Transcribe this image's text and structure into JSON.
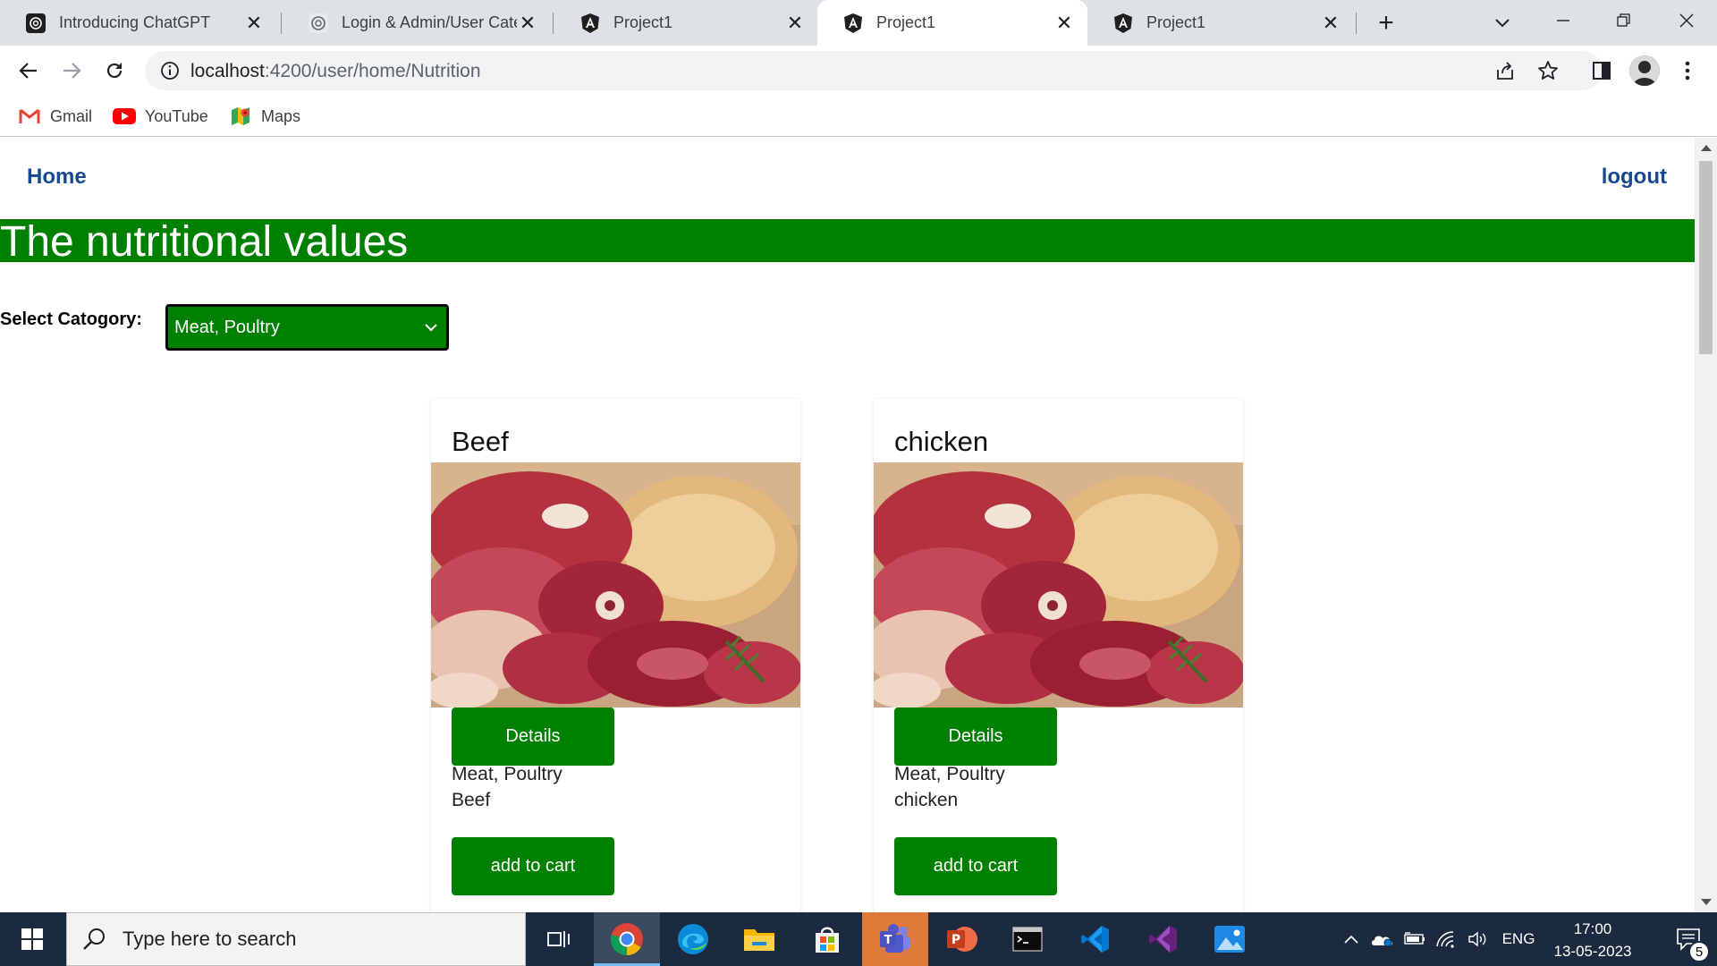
{
  "browser": {
    "tabs": [
      {
        "title": "Introducing ChatGPT",
        "icon": "openai-icon"
      },
      {
        "title": "Login & Admin/User Cate",
        "icon": "openai-icon"
      },
      {
        "title": "Project1",
        "icon": "angular-icon"
      },
      {
        "title": "Project1",
        "icon": "angular-icon",
        "active": true
      },
      {
        "title": "Project1",
        "icon": "angular-icon"
      }
    ],
    "url_host": "localhost",
    "url_path": ":4200/user/home/Nutrition",
    "bookmarks": [
      {
        "label": "Gmail",
        "icon": "gmail-icon"
      },
      {
        "label": "YouTube",
        "icon": "youtube-icon"
      },
      {
        "label": "Maps",
        "icon": "maps-icon"
      }
    ]
  },
  "page": {
    "nav": {
      "home": "Home",
      "logout": "logout"
    },
    "banner_title": "The nutritional values",
    "category_label": "Select Catogory:",
    "category_selected": "Meat, Poultry",
    "accent_color": "#008000",
    "link_color": "#16498f",
    "cards": [
      {
        "name": "Beef",
        "details_label": "Details",
        "category": "Meat, Poultry",
        "item": "Beef",
        "cart_label": "add to cart"
      },
      {
        "name": "chicken",
        "details_label": "Details",
        "category": "Meat, Poultry",
        "item": "chicken",
        "cart_label": "add to cart"
      }
    ]
  },
  "taskbar": {
    "search_placeholder": "Type here to search",
    "language": "ENG",
    "time": "17:00",
    "date": "13-05-2023",
    "notification_count": "5"
  }
}
